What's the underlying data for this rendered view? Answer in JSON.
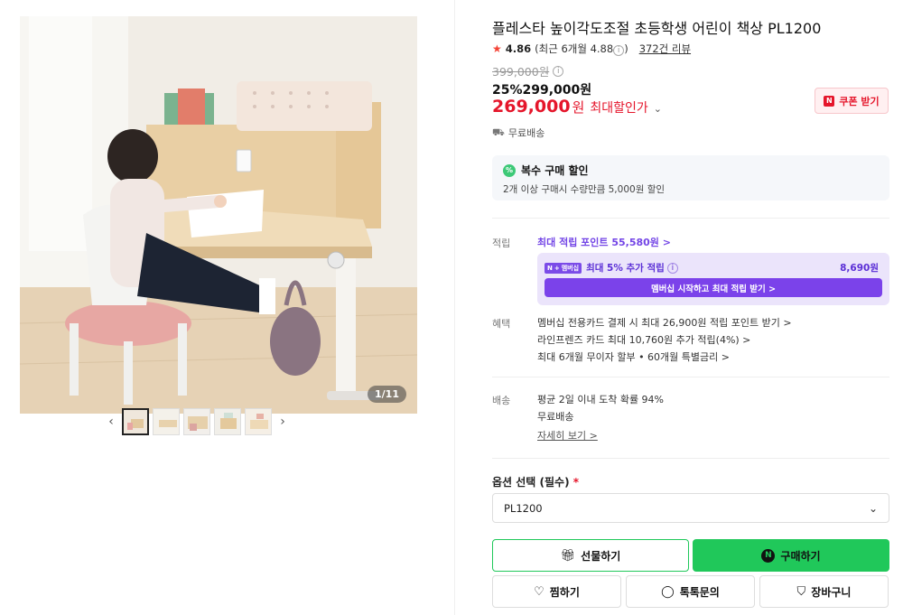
{
  "gallery": {
    "page_indicator": "1/11",
    "prev_icon": "chevron-left-icon",
    "next_icon": "chevron-right-icon",
    "thumb_count": 5
  },
  "product": {
    "title": "플레스타 높이각도조절 초등학생 어린이 책상 PL1200",
    "rating": "4.86",
    "rating_recent": "(최근 6개월 4.88",
    "rating_recent_close": ")",
    "review_count": "372건 리뷰",
    "original_price": "399,000원",
    "discount_line": "25%299,000원",
    "final_price": "269,000",
    "final_won": "원",
    "max_discount": "최대할인가",
    "coupon_label": "쿠폰 받기",
    "free_shipping": "무료배송"
  },
  "multi_buy": {
    "badge": "%",
    "title": "복수 구매 할인",
    "desc": "2개 이상 구매시 수량만큼 5,000원 할인"
  },
  "points": {
    "label": "적립",
    "link": "최대 적립 포인트 55,580원 >",
    "member_logo_n": "N",
    "member_logo_plus": "+",
    "member_logo_text": "멤버십",
    "member_text": "최대 5% 추가 적립",
    "member_amount": "8,690원",
    "member_button": "멤버십 시작하고 최대 적립 받기 >"
  },
  "benefits": {
    "label": "혜택",
    "lines": [
      "멤버십 전용카드 결제 시 최대 26,900원 적립 포인트 받기 >",
      "라인프렌즈 카드 최대 10,760원 추가 적립(4%) >",
      "최대 6개월 무이자 할부 • 60개월 특별금리 >"
    ]
  },
  "shipping": {
    "label": "배송",
    "line1": "평균 2일 이내 도착 확률 94%",
    "line2": "무료배송",
    "detail_link": "자세히 보기 >"
  },
  "option": {
    "label": "옵션 선택 (필수)",
    "required_mark": "*",
    "selected": "PL1200"
  },
  "buttons": {
    "gift": "선물하기",
    "buy": "구매하기",
    "buy_badge": "N",
    "wish": "찜하기",
    "talk": "톡톡문의",
    "cart": "장바구니"
  },
  "colors": {
    "accent_red": "#e5162b",
    "naver_green": "#20c85a",
    "membership_purple": "#7b42ea"
  }
}
